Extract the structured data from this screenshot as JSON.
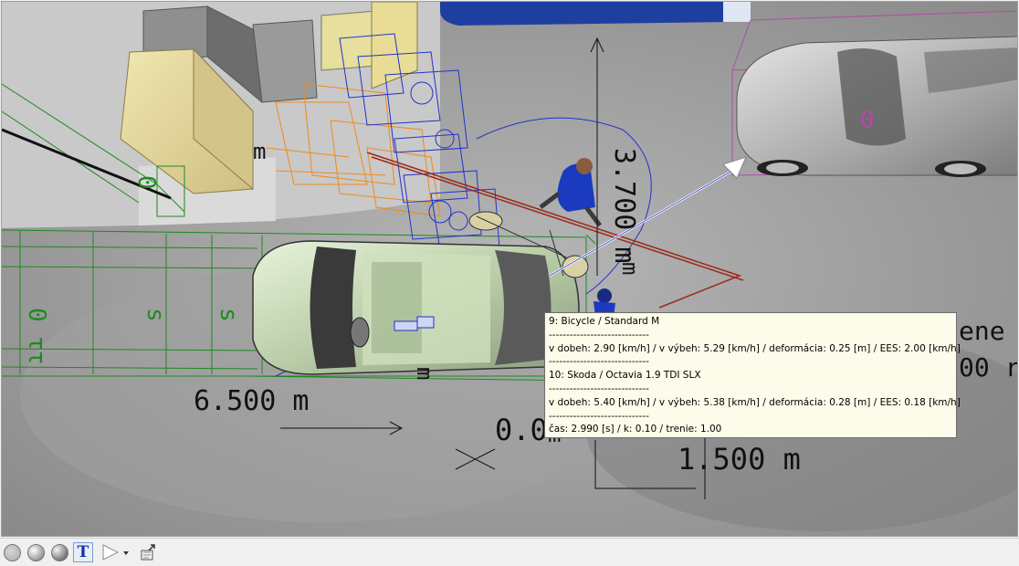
{
  "scene": {
    "dimensions": {
      "d1": "6.500 m",
      "d2": "3.700 m",
      "d3": "1.500 m",
      "d4": "0.0",
      "d5": "m",
      "d6": "m",
      "d7": "m",
      "d8": "m",
      "d9": "m",
      "right_partial_1": "ene",
      "right_partial_2": "00 r"
    },
    "labels": {
      "green_0": "0",
      "green_s1": "s",
      "green_s2": "s",
      "green_num": "0 ττ",
      "pink_0": "0"
    }
  },
  "tooltip": {
    "line1": "9: Bicycle / Standard M",
    "sep1": "-----------------------------",
    "line2": "v dobeh: 2.90 [km/h] / v výbeh: 5.29 [km/h] / deformácia: 0.25 [m] / EES: 2.00 [km/h]",
    "sep2": "-----------------------------",
    "line3": "10: Skoda / Octavia 1.9 TDI SLX",
    "sep3": "-----------------------------",
    "line4": "v dobeh: 5.40 [km/h] / v výbeh: 5.38 [km/h] / deformácia: 0.28 [m] / EES: 0.18 [km/h]",
    "sep4": "-----------------------------",
    "line5": "čas: 2.990 [s] / k: 0.10 / trenie: 1.00"
  },
  "toolbar": {
    "items": [
      "render-flat",
      "render-smooth",
      "render-shaded",
      "text-toggle",
      "play",
      "export"
    ],
    "text_label": "T"
  },
  "colors": {
    "green_mesh": "#1f8a1f",
    "blue_mesh": "#2233cc",
    "orange_mesh": "#f08a1a",
    "red_line": "#9a2a1a",
    "pink_mesh": "#b04aa8"
  }
}
